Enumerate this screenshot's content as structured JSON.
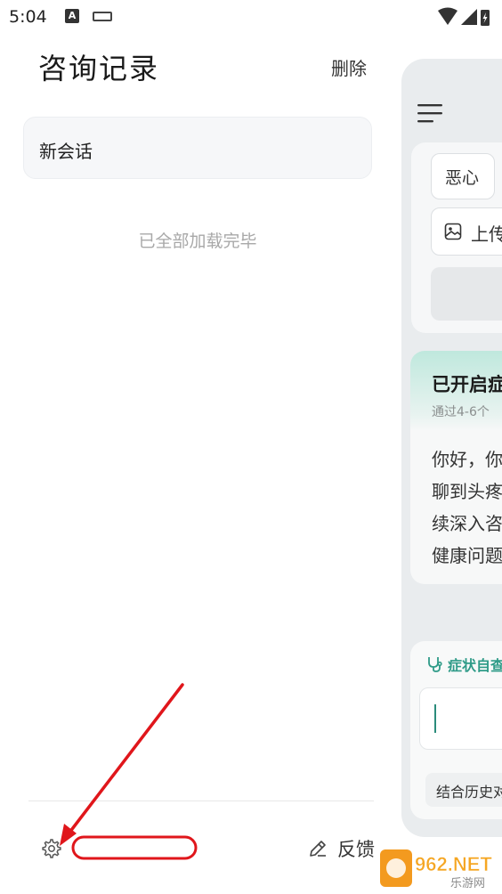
{
  "status_bar": {
    "time": "5:04",
    "notification_icon": "A"
  },
  "drawer": {
    "title": "咨询记录",
    "delete_label": "删除",
    "sessions": [
      {
        "label": "新会话"
      }
    ],
    "loaded_all_text": "已全部加载完毕",
    "feedback_label": "反馈"
  },
  "chat_preview": {
    "chip_nausea": "恶心",
    "chip_upload": "上传",
    "info_title": "已开启症",
    "info_subtitle": "通过4-6个",
    "info_body": [
      "你好，你",
      "聊到头疼",
      "续深入咨",
      "健康问题"
    ],
    "symptom_tag": "症状自查",
    "history_chip": "结合历史对"
  },
  "watermark": {
    "brand": "962.NET",
    "sub": "乐游网"
  },
  "colors": {
    "annotation_red": "#e0161b",
    "accent_teal": "#2f9b88",
    "panel_bg": "#e9ecee"
  },
  "icons": {
    "settings": "gear-icon",
    "feedback": "pencil-icon",
    "menu": "hamburger-menu-icon",
    "upload": "image-icon",
    "symptom": "stethoscope-icon"
  }
}
